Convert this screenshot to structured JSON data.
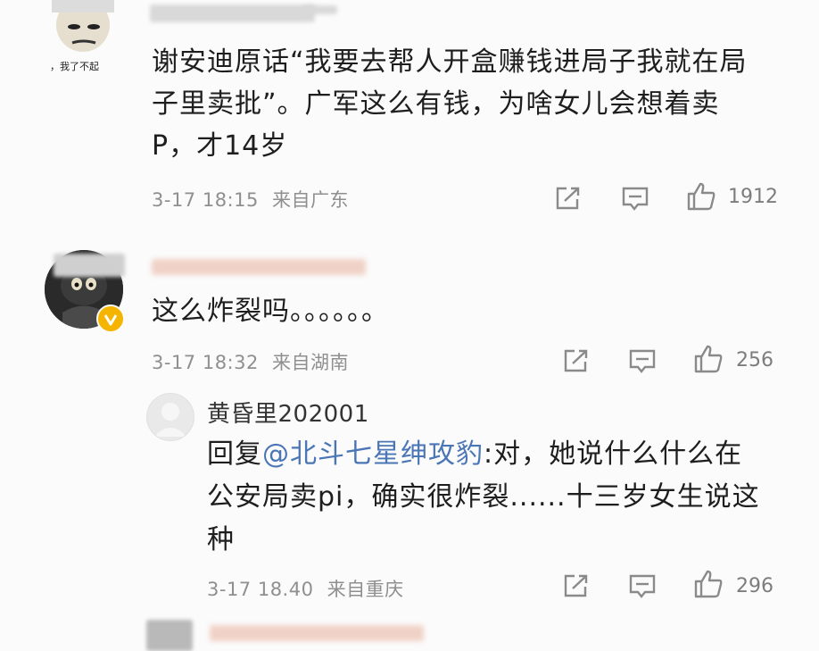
{
  "comments": [
    {
      "avatar_icon": "meme-face-icon",
      "avatar_caption": "，我了不起",
      "text_lines": [
        "谢安迪原话“我要去帮人开盒赚钱进局子我就在局",
        "子里卖批”。广军这么有钱，为啥女儿会想着卖",
        "P，才14岁"
      ],
      "time": "3-17 18:15",
      "location": "来自广东",
      "likes": "1912"
    },
    {
      "avatar_icon": "cat-avatar-icon",
      "verified_icon": "verified-badge-icon",
      "text": "这么炸裂吗。。。。。。",
      "time": "3-17 18:32",
      "location": "来自湖南",
      "likes": "256"
    }
  ],
  "reply": {
    "username": "黄昏里202001",
    "prefix": "回复",
    "mention": "@北斗七星绅攻豹",
    "text_lines": [
      ":对，她说什么什么在",
      "公安局卖pi，确实很炸裂......十三岁女生说这",
      "种"
    ],
    "time": "3-17 18.40",
    "location": "来自重庆",
    "likes": "296"
  },
  "icons": {
    "share": "share-icon",
    "comment": "comment-icon",
    "like": "thumbs-up-icon",
    "placeholder_avatar": "default-avatar-icon"
  },
  "colors": {
    "mention": "#4a76b6",
    "verified": "#f5b400",
    "meta": "#8f8f8f"
  }
}
